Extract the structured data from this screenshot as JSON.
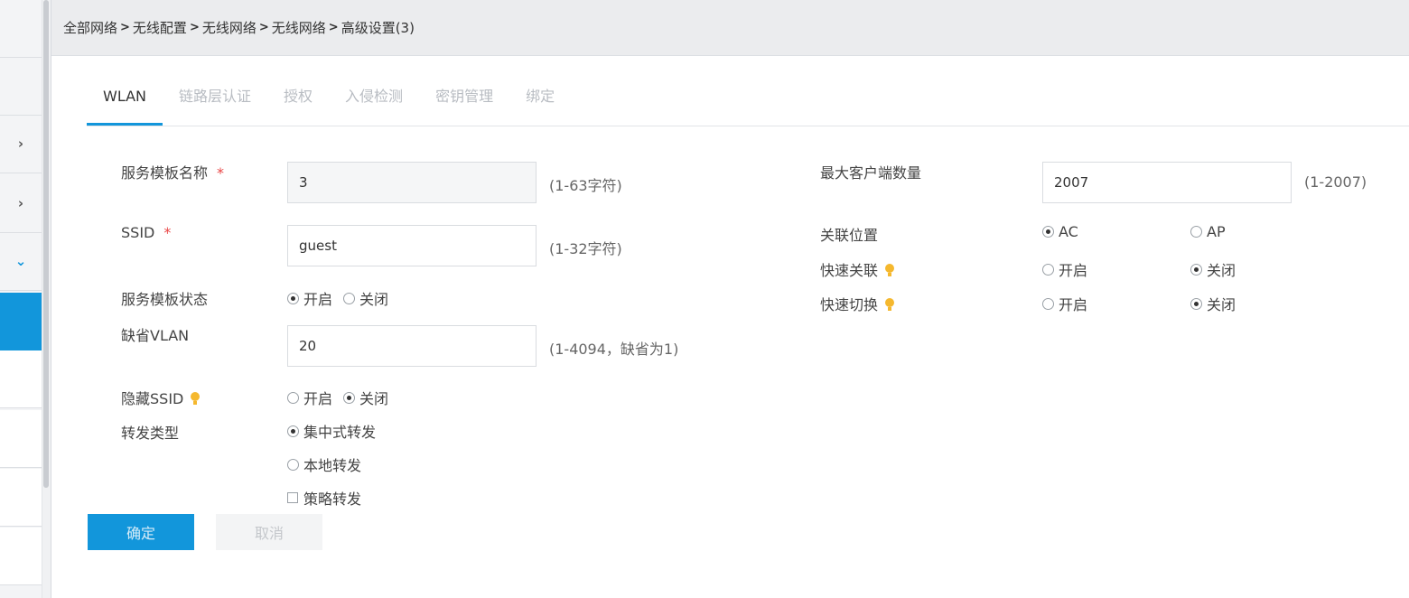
{
  "breadcrumb": [
    "全部网络",
    "无线配置",
    "无线网络",
    "无线网络",
    "高级设置(3)"
  ],
  "tabs": [
    {
      "label": "WLAN",
      "active": true
    },
    {
      "label": "链路层认证",
      "active": false
    },
    {
      "label": "授权",
      "active": false
    },
    {
      "label": "入侵检测",
      "active": false
    },
    {
      "label": "密钥管理",
      "active": false
    },
    {
      "label": "绑定",
      "active": false
    }
  ],
  "form": {
    "template_name": {
      "label": "服务模板名称",
      "required_mark": "*",
      "value": "3",
      "hint": "(1-63字符)"
    },
    "ssid": {
      "label": "SSID",
      "required_mark": "*",
      "value": "guest",
      "hint": "(1-32字符)"
    },
    "template_status": {
      "label": "服务模板状态",
      "on": "开启",
      "off": "关闭",
      "selected": "on"
    },
    "default_vlan": {
      "label": "缺省VLAN",
      "value": "20",
      "hint": "(1-4094，缺省为1)"
    },
    "hide_ssid": {
      "label": "隐藏SSID",
      "on": "开启",
      "off": "关闭",
      "selected": "off",
      "icon": "lightbulb-icon"
    },
    "forward_type": {
      "label": "转发类型",
      "central": "集中式转发",
      "local": "本地转发",
      "policy": "策略转发",
      "selected": "central"
    },
    "max_clients": {
      "label": "最大客户端数量",
      "value": "2007",
      "hint": "(1-2007)"
    },
    "assoc_location": {
      "label": "关联位置",
      "ac": "AC",
      "ap": "AP",
      "selected": "ac"
    },
    "fast_assoc": {
      "label": "快速关联",
      "on": "开启",
      "off": "关闭",
      "selected": "off",
      "icon": "lightbulb-icon"
    },
    "fast_switch": {
      "label": "快速切换",
      "on": "开启",
      "off": "关闭",
      "selected": "off",
      "icon": "lightbulb-icon"
    }
  },
  "buttons": {
    "confirm": "确定",
    "cancel": "取消"
  },
  "colors": {
    "accent": "#1296db",
    "required": "#e94545",
    "hint_bulb": "#f5b82e"
  }
}
